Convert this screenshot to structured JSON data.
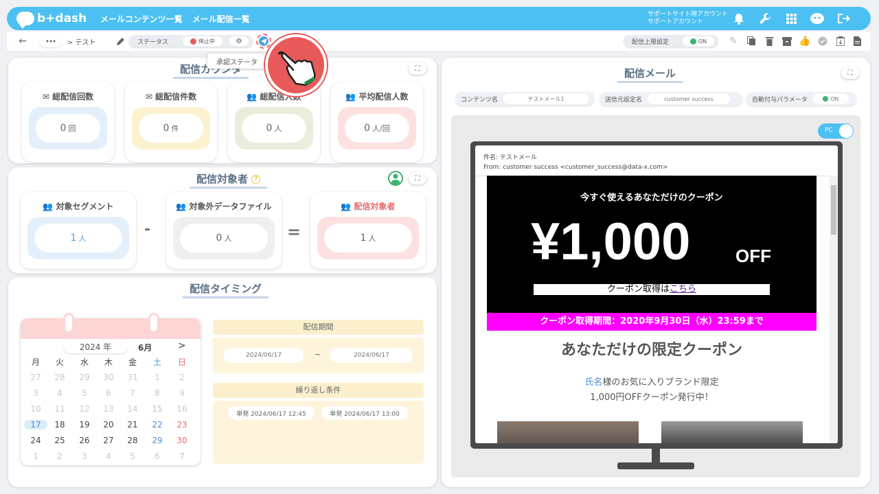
{
  "header": {
    "logo": "b+dash",
    "nav": [
      "メールコンテンツ一覧",
      "メール配信一覧"
    ],
    "account_line1": "サポートサイト用アカウント",
    "account_line2": "サポートアカウント",
    "icons": [
      "bell-icon",
      "wrench-icon",
      "grid-icon",
      "support-icon",
      "logout-icon"
    ]
  },
  "toolbar": {
    "breadcrumb_dots": "•••",
    "breadcrumb": "> テスト",
    "status_label": "ステータス",
    "status_value": "停止中",
    "limit_label": "配信上限設定",
    "limit_value": "ON",
    "tooltip": "承認ステータ"
  },
  "counts": {
    "title": "配信カウンタ",
    "cards": [
      {
        "label": "総配信回数",
        "value": "0",
        "unit": "回"
      },
      {
        "label": "総配信件数",
        "value": "0",
        "unit": "件"
      },
      {
        "label": "総配信人数",
        "value": "0",
        "unit": "人"
      },
      {
        "label": "平均配信人数",
        "value": "0",
        "unit": "人/回"
      }
    ]
  },
  "target": {
    "title": "配信対象者",
    "segment_label": "対象セグメント",
    "segment_value": "1",
    "segment_unit": "人",
    "minus": "-",
    "excluded_label": "対象外データファイル",
    "excluded_value": "0",
    "excluded_unit": "人",
    "equals": "=",
    "result_label": "配信対象者",
    "result_value": "1",
    "result_unit": "人"
  },
  "timing": {
    "title": "配信タイミング",
    "cal_year": "2024 年",
    "cal_month": "6月",
    "cal_next": ">",
    "weekdays": [
      "月",
      "火",
      "水",
      "木",
      "金",
      "土",
      "日"
    ],
    "weeks": [
      [
        "27",
        "28",
        "29",
        "30",
        "31",
        "1",
        "2"
      ],
      [
        "3",
        "4",
        "5",
        "6",
        "7",
        "8",
        "9"
      ],
      [
        "10",
        "11",
        "12",
        "13",
        "14",
        "15",
        "16"
      ],
      [
        "17",
        "18",
        "19",
        "20",
        "21",
        "22",
        "23"
      ],
      [
        "24",
        "25",
        "26",
        "27",
        "28",
        "29",
        "30"
      ],
      [
        "1",
        "2",
        "3",
        "4",
        "5",
        "6",
        "7"
      ]
    ],
    "period_label": "配信期間",
    "period_start": "2024/06/17",
    "period_sep": "~",
    "period_end": "2024/06/17",
    "repeat_label": "繰り返し条件",
    "repeat_items": [
      "単発 2024/06/17 12:45",
      "単発 2024/06/17 13:00"
    ]
  },
  "mail": {
    "title": "配信メール",
    "content_name_label": "コンテンツ名",
    "content_name_value": "テストメール1",
    "sender_label": "送信元設定名",
    "sender_value": "customer success",
    "param_label": "自動付与パラメータ",
    "param_value": "ON",
    "device_toggle": "PC",
    "subject": "件名: テストメール",
    "from": "From: customer success <customer_success@data-x.com>",
    "banner_top": "今すぐ使えるあなただけのクーポン",
    "banner_amount": "¥1,000",
    "banner_off": "OFF",
    "banner_link_prefix": "クーポン取得は",
    "banner_link": "こちら",
    "period_bar": "クーポン取得期間：2020年9月30日（水）23:59まで",
    "headline": "あなただけの限定クーポン",
    "body_name": "氏名",
    "body_line1_rest": "様のお気に入りブランド限定",
    "body_line2": "1,000円OFFクーポン発行中！"
  },
  "colors": {
    "brand": "#4cc0f2",
    "blue_well": "#e3f0fb",
    "yellow_well": "#fdf2cf",
    "green_well": "#e8eedb",
    "pink_well": "#fde1e0",
    "magenta": "#ff00ff"
  }
}
